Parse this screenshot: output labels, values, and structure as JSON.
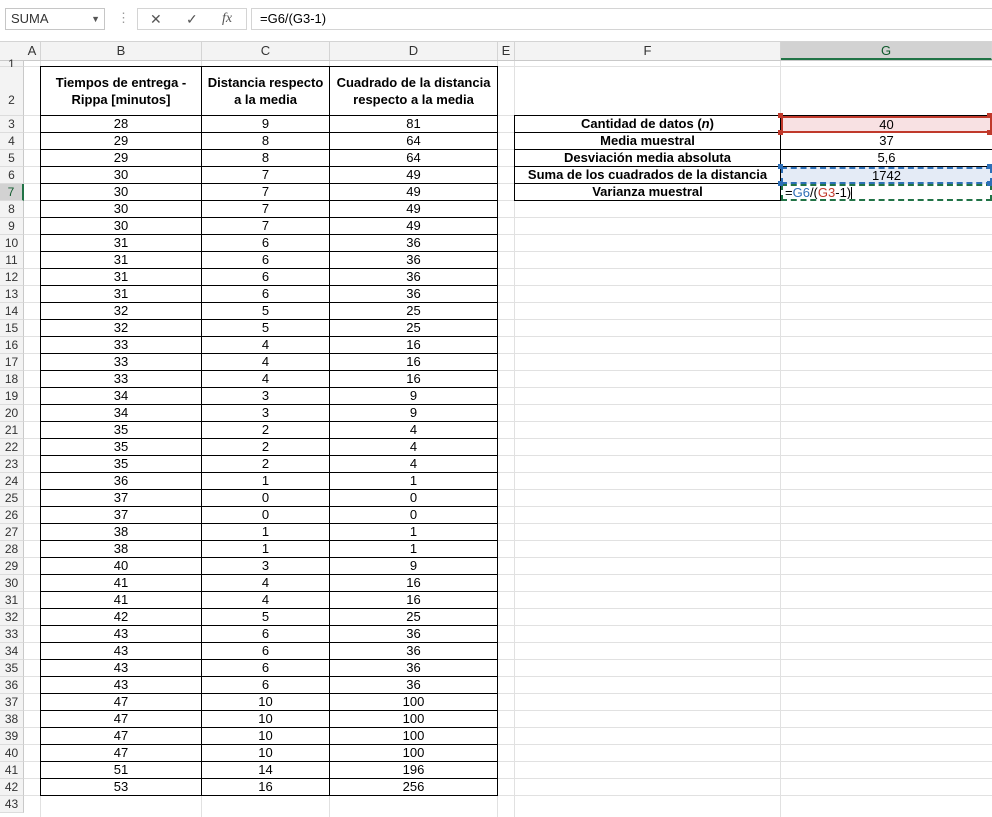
{
  "formula_bar": {
    "name_box": "SUMA",
    "cancel_icon": "✕",
    "enter_icon": "✓",
    "fx_icon": "fx",
    "formula": "=G6/(G3-1)"
  },
  "columns": [
    "A",
    "B",
    "C",
    "D",
    "E",
    "F",
    "G"
  ],
  "row_numbers": [
    "1",
    "2",
    "3",
    "4",
    "5",
    "6",
    "7",
    "8",
    "9",
    "10",
    "11",
    "12",
    "13",
    "14",
    "15",
    "16",
    "17",
    "18",
    "19",
    "20",
    "21",
    "22",
    "23",
    "24",
    "25",
    "26",
    "27",
    "28",
    "29",
    "30",
    "31",
    "32",
    "33",
    "34",
    "35",
    "36",
    "37",
    "38",
    "39",
    "40",
    "41",
    "42",
    "43"
  ],
  "table": {
    "headers": [
      "Tiempos de entrega - Rippa [minutos]",
      "Distancia respecto a la media",
      "Cuadrado de la distancia respecto a la media"
    ],
    "rows": [
      [
        "28",
        "9",
        "81"
      ],
      [
        "29",
        "8",
        "64"
      ],
      [
        "29",
        "8",
        "64"
      ],
      [
        "30",
        "7",
        "49"
      ],
      [
        "30",
        "7",
        "49"
      ],
      [
        "30",
        "7",
        "49"
      ],
      [
        "30",
        "7",
        "49"
      ],
      [
        "31",
        "6",
        "36"
      ],
      [
        "31",
        "6",
        "36"
      ],
      [
        "31",
        "6",
        "36"
      ],
      [
        "31",
        "6",
        "36"
      ],
      [
        "32",
        "5",
        "25"
      ],
      [
        "32",
        "5",
        "25"
      ],
      [
        "33",
        "4",
        "16"
      ],
      [
        "33",
        "4",
        "16"
      ],
      [
        "33",
        "4",
        "16"
      ],
      [
        "34",
        "3",
        "9"
      ],
      [
        "34",
        "3",
        "9"
      ],
      [
        "35",
        "2",
        "4"
      ],
      [
        "35",
        "2",
        "4"
      ],
      [
        "35",
        "2",
        "4"
      ],
      [
        "36",
        "1",
        "1"
      ],
      [
        "37",
        "0",
        "0"
      ],
      [
        "37",
        "0",
        "0"
      ],
      [
        "38",
        "1",
        "1"
      ],
      [
        "38",
        "1",
        "1"
      ],
      [
        "40",
        "3",
        "9"
      ],
      [
        "41",
        "4",
        "16"
      ],
      [
        "41",
        "4",
        "16"
      ],
      [
        "42",
        "5",
        "25"
      ],
      [
        "43",
        "6",
        "36"
      ],
      [
        "43",
        "6",
        "36"
      ],
      [
        "43",
        "6",
        "36"
      ],
      [
        "43",
        "6",
        "36"
      ],
      [
        "47",
        "10",
        "100"
      ],
      [
        "47",
        "10",
        "100"
      ],
      [
        "47",
        "10",
        "100"
      ],
      [
        "47",
        "10",
        "100"
      ],
      [
        "51",
        "14",
        "196"
      ],
      [
        "53",
        "16",
        "256"
      ]
    ]
  },
  "summary": {
    "rows": [
      {
        "label_pre": "Cantidad de datos (",
        "label_em": "n",
        "label_post": ")",
        "value": "40"
      },
      {
        "label_pre": "Media muestral",
        "label_em": "",
        "label_post": "",
        "value": "37"
      },
      {
        "label_pre": "Desviación media absoluta",
        "label_em": "",
        "label_post": "",
        "value": "5,6"
      },
      {
        "label_pre": "Suma de los cuadrados de la distancia",
        "label_em": "",
        "label_post": "",
        "value": "1742"
      },
      {
        "label_pre": "Varianza muestral",
        "label_em": "",
        "label_post": "",
        "value": ""
      }
    ],
    "edit": {
      "eq": "=",
      "ref1": "G6",
      "mid": "/(",
      "ref2": "G3",
      "tail": "-1)"
    }
  },
  "colors": {
    "accent": "#217346",
    "ref_blue": "#2d6fb7",
    "ref_red": "#c0392b"
  }
}
